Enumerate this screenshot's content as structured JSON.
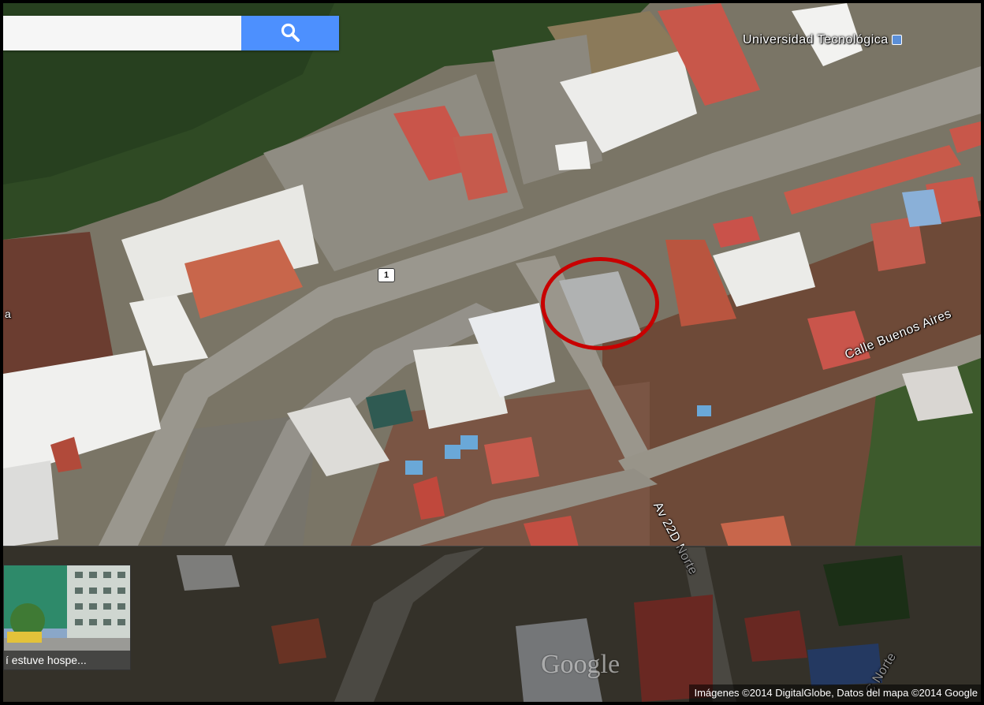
{
  "search": {
    "placeholder": "",
    "value": "",
    "button_icon": "search-icon"
  },
  "labels": {
    "university": "Universidad Tecnológica",
    "calle_buenos_aires": "Calle Buenos Aires",
    "av_22d_norte": "Av 22D Norte",
    "c_norte": "C Norte",
    "edge_fragment": "a"
  },
  "route_shield": "1",
  "street_view": {
    "caption": "í estuve hospe..."
  },
  "watermark": "Google",
  "attribution": "Imágenes ©2014 DigitalGlobe, Datos del mapa ©2014 Google",
  "colors": {
    "search_button": "#4d90fe",
    "highlight_circle": "#c80000"
  }
}
